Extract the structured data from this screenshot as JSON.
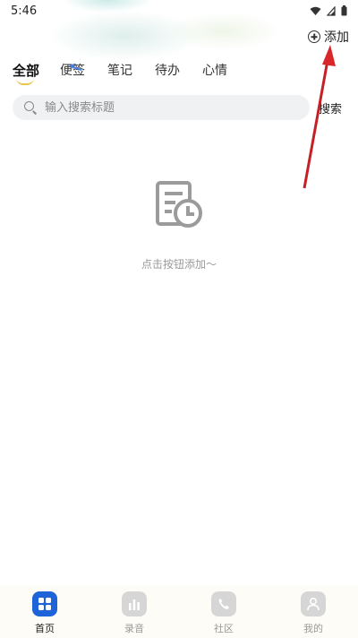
{
  "status": {
    "time": "5:46"
  },
  "header": {
    "add_label": "添加"
  },
  "tabs": [
    {
      "label": "全部",
      "active": true
    },
    {
      "label": "便签",
      "active": false
    },
    {
      "label": "笔记",
      "active": false
    },
    {
      "label": "待办",
      "active": false
    },
    {
      "label": "心情",
      "active": false
    }
  ],
  "search": {
    "placeholder": "输入搜索标题",
    "button_label": "搜索"
  },
  "empty_state": {
    "message": "点击按钮添加～"
  },
  "bottom_nav": [
    {
      "label": "首页",
      "icon": "grid-icon",
      "active": true
    },
    {
      "label": "录音",
      "icon": "bar-chart-icon",
      "active": false
    },
    {
      "label": "社区",
      "icon": "phone-icon",
      "active": false
    },
    {
      "label": "我的",
      "icon": "person-icon",
      "active": false
    }
  ],
  "colors": {
    "accent": "#1f63d9",
    "tab_underline": "#e8c64a",
    "annotation_arrow": "#d8262b"
  }
}
